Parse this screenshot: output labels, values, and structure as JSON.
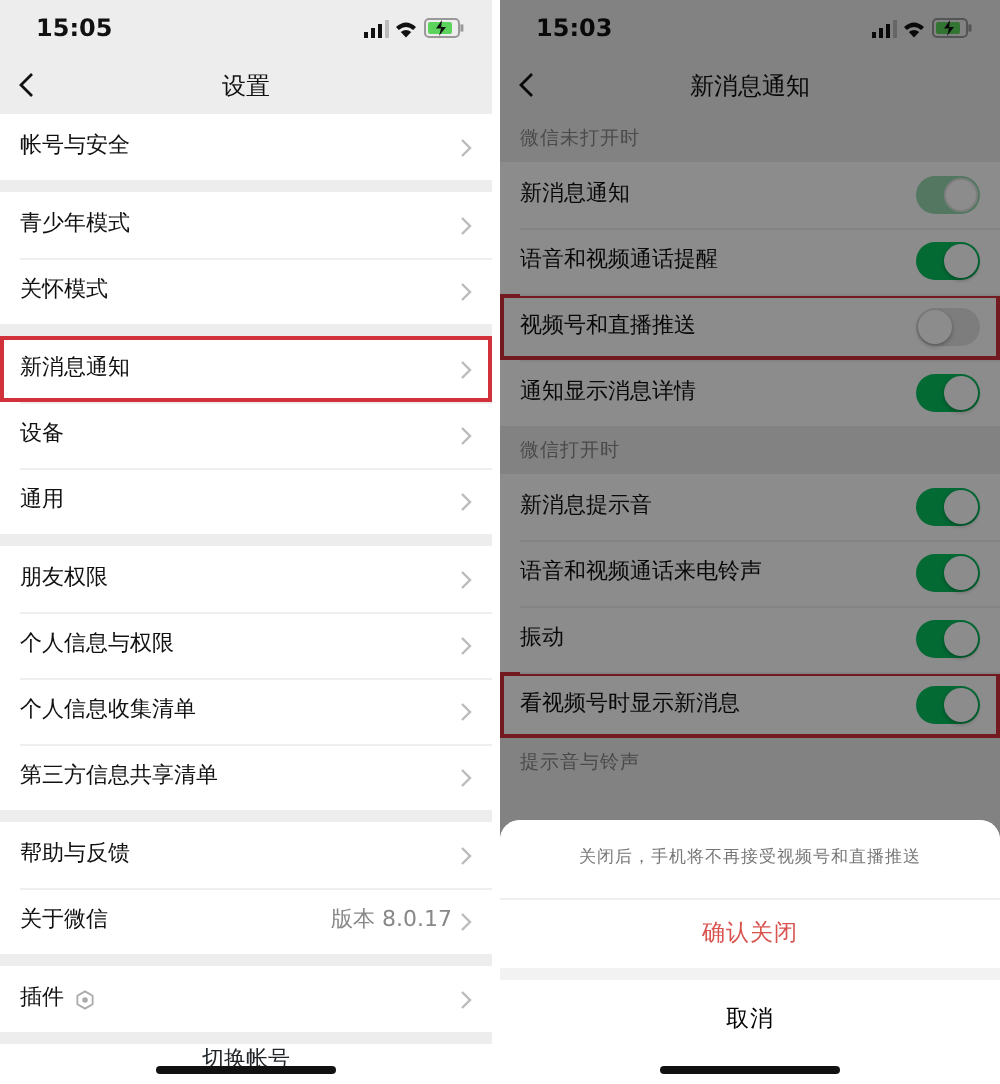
{
  "left_screen": {
    "status_bar": {
      "time": "15:05"
    },
    "title": "设置",
    "sections": [
      [
        {
          "label": "帐号与安全",
          "highlighted": false
        }
      ],
      [
        {
          "label": "青少年模式",
          "highlighted": false
        },
        {
          "label": "关怀模式",
          "highlighted": false
        }
      ],
      [
        {
          "label": "新消息通知",
          "highlighted": true
        },
        {
          "label": "设备",
          "highlighted": false
        },
        {
          "label": "通用",
          "highlighted": false
        }
      ],
      [
        {
          "label": "朋友权限",
          "highlighted": false
        },
        {
          "label": "个人信息与权限",
          "highlighted": false
        },
        {
          "label": "个人信息收集清单",
          "highlighted": false
        },
        {
          "label": "第三方信息共享清单",
          "highlighted": false
        }
      ],
      [
        {
          "label": "帮助与反馈",
          "highlighted": false
        },
        {
          "label": "关于微信",
          "value": "版本 8.0.17",
          "highlighted": false
        }
      ],
      [
        {
          "label": "插件",
          "badge_icon": true,
          "highlighted": false
        }
      ]
    ],
    "bottom_button": "切换帐号"
  },
  "right_screen": {
    "status_bar": {
      "time": "15:03"
    },
    "title": "新消息通知",
    "groups": [
      {
        "header": "微信未打开时",
        "items": [
          {
            "label": "新消息通知",
            "on": true,
            "disabled": true,
            "highlighted": false
          },
          {
            "label": "语音和视频通话提醒",
            "on": true,
            "disabled": false,
            "highlighted": false
          },
          {
            "label": "视频号和直播推送",
            "on": false,
            "disabled": false,
            "highlighted": true
          },
          {
            "label": "通知显示消息详情",
            "on": true,
            "disabled": false,
            "highlighted": false
          }
        ]
      },
      {
        "header": "微信打开时",
        "items": [
          {
            "label": "新消息提示音",
            "on": true,
            "disabled": false,
            "highlighted": false
          },
          {
            "label": "语音和视频通话来电铃声",
            "on": true,
            "disabled": false,
            "highlighted": false
          },
          {
            "label": "振动",
            "on": true,
            "disabled": false,
            "highlighted": false
          },
          {
            "label": "看视频号时显示新消息",
            "on": true,
            "disabled": false,
            "highlighted": true
          }
        ]
      },
      {
        "header": "提示音与铃声"
      }
    ],
    "action_sheet": {
      "message": "关闭后，手机将不再接受视频号和直播推送",
      "confirm": "确认关闭",
      "cancel": "取消"
    }
  }
}
